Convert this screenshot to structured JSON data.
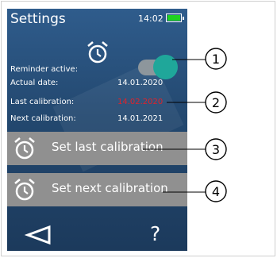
{
  "header": {
    "title": "Settings",
    "time": "14:02"
  },
  "settings": {
    "reminder_label": "Reminder active:",
    "reminder_on": true,
    "actual_date_label": "Actual date:",
    "actual_date_value": "14.01.2020",
    "last_calibration_label": "Last calibration:",
    "last_calibration_value": "14.02.2020",
    "next_calibration_label": "Next calibration:",
    "next_calibration_value": "14.01.2021"
  },
  "buttons": {
    "set_last": "Set last calibration",
    "set_next": "Set next calibration"
  },
  "footer": {
    "help": "?"
  },
  "callouts": [
    "1",
    "2",
    "3",
    "4"
  ],
  "colors": {
    "screen_bg": "#23486f",
    "toggle_knob": "#1fa79a",
    "warning_value": "#e0222a",
    "battery": "#1fd11f",
    "button_bg": "#909090"
  },
  "icons": [
    "alarm-clock-icon",
    "back-arrow-icon",
    "help-icon",
    "battery-icon"
  ]
}
